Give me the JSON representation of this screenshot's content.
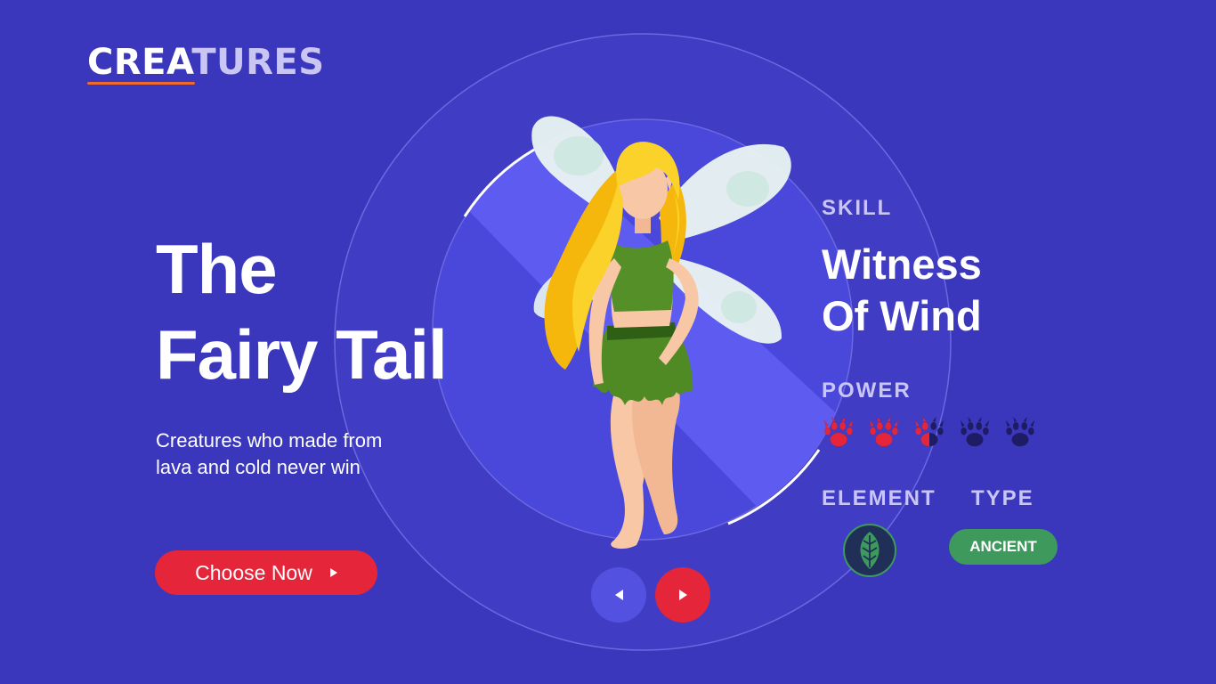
{
  "brand": {
    "logo_part1": "CREA",
    "logo_part2": "TURES"
  },
  "hero": {
    "title_line1": "The",
    "title_line2": "Fairy Tail",
    "subtitle_line1": "Creatures who made from",
    "subtitle_line2": "lava and cold never win",
    "cta_label": "Choose Now"
  },
  "creature": {
    "skill_label": "SKILL",
    "skill_line1": "Witness",
    "skill_line2": "Of Wind",
    "power_label": "POWER",
    "power_rating": 2.5,
    "power_max": 5,
    "element_label": "ELEMENT",
    "element_icon": "leaf-icon",
    "type_label": "TYPE",
    "type_value": "ANCIENT"
  },
  "carousel": {
    "prev_icon": "chevron-left-icon",
    "next_icon": "chevron-right-icon"
  },
  "colors": {
    "background": "#3a37bd",
    "accent_red": "#e5263a",
    "accent_orange": "#f06a2b",
    "label": "#c9c6f3",
    "paw_filled": "#e5263a",
    "paw_empty": "#1f1c66",
    "type_badge": "#3d9a5c"
  }
}
